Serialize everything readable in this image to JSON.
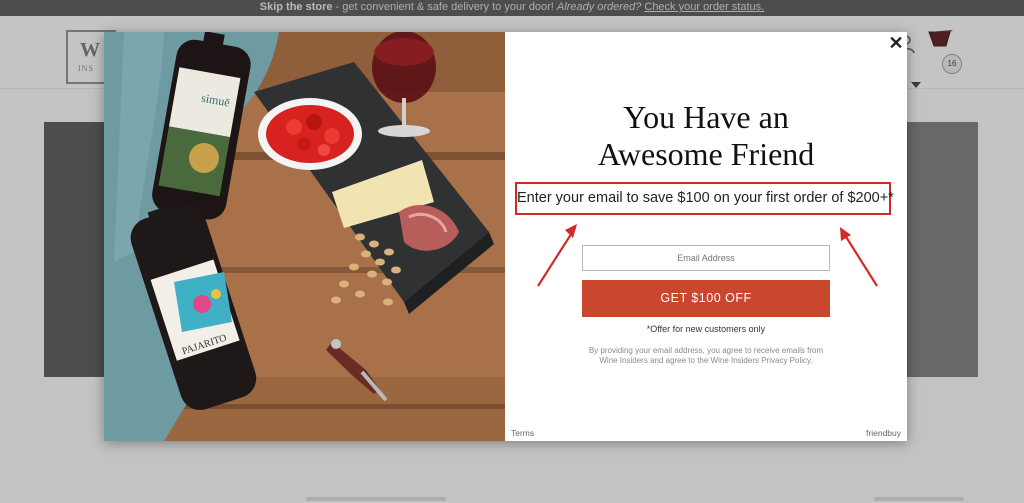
{
  "topbar": {
    "skip_label": "Skip the store",
    "message": " - get convenient & safe delivery to your door! ",
    "already": "Already ordered?",
    "status_link": "Check your order status."
  },
  "header": {
    "logo_letter": "W",
    "logo_sub": "INS",
    "cart_count": "16"
  },
  "modal": {
    "close_glyph": "✕",
    "title_line1": "You Have an",
    "title_line2": "Awesome Friend",
    "callout": "Enter your email to save $100 on your first order of $200+*",
    "email_placeholder": "Email Address",
    "cta_label": "GET $100 OFF",
    "offer_note": "*Offer for new customers only",
    "legal": "By providing your email address, you agree to receive emails from Wine Insiders and agree to the Wine Insiders Privacy Policy.",
    "terms_link": "Terms",
    "powered_by": "friendbuy"
  },
  "photo": {
    "label_top_bottle": "simuē",
    "label_bottom_bottle": "PAJARITO"
  },
  "colors": {
    "accent": "#c8472e",
    "callout_border": "#d62828"
  },
  "icons": [
    "search-icon",
    "heart-icon",
    "account-icon",
    "cart-icon",
    "close-icon",
    "arrow-icon"
  ]
}
